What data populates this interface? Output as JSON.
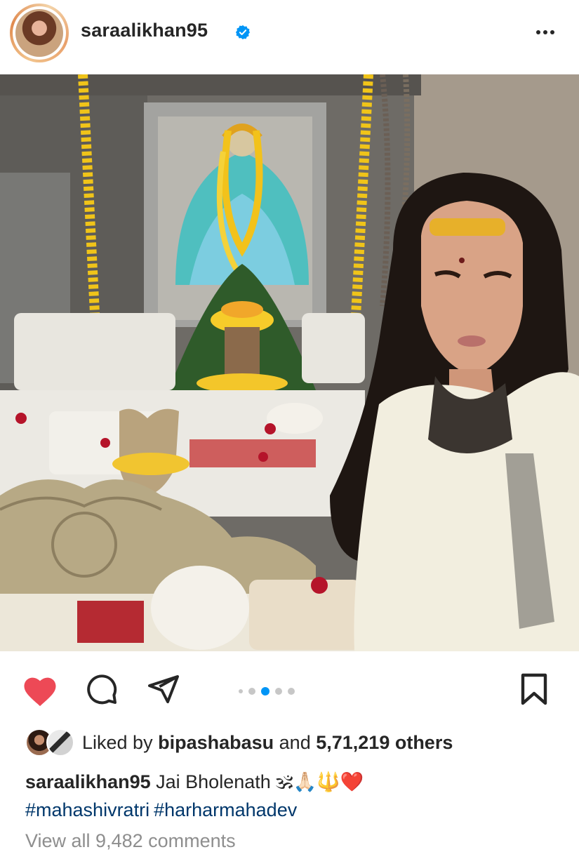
{
  "post": {
    "username": "saraalikhan95",
    "verified": true,
    "more_icon": "more-horizontal-icon"
  },
  "actions": {
    "like_icon": "heart-filled-icon",
    "like_color": "#ed4956",
    "comment_icon": "comment-icon",
    "share_icon": "send-icon",
    "save_icon": "bookmark-icon",
    "carousel_total": 5,
    "carousel_active": 3,
    "carousel_active_color": "#0095f6"
  },
  "likes": {
    "prefix": "Liked by",
    "user": "bipashabasu",
    "conjunction": "and",
    "count": "5,71,219 others"
  },
  "caption": {
    "user": "saraalikhan95",
    "text": "Jai Bholenath",
    "emojis": "🕉🙏🏻🔱❤️",
    "hashtags": [
      "#mahashivratri",
      "#harharmahadev"
    ]
  },
  "comments": {
    "view_all": "View all 9,482 comments"
  }
}
